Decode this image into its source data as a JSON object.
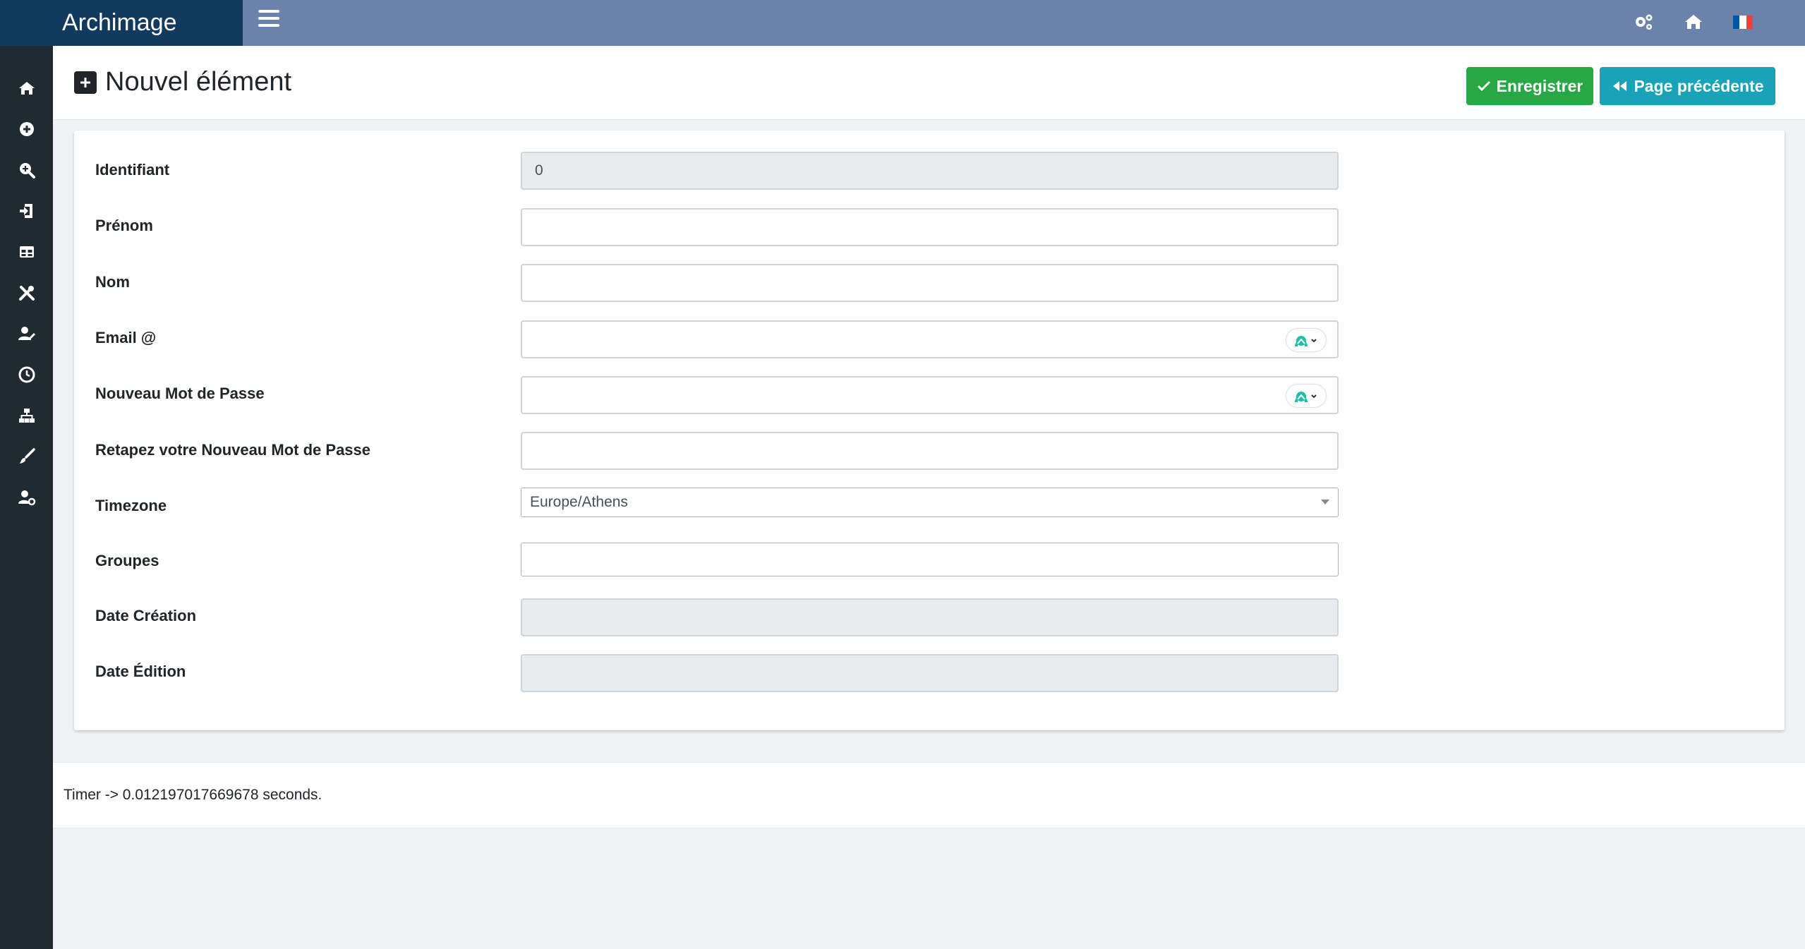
{
  "app": {
    "title": "Archimage"
  },
  "topbar": {
    "icons": [
      "gears-icon",
      "home-icon",
      "french-flag-icon"
    ],
    "flag_colors": [
      "#0055a4",
      "#ffffff",
      "#ef4135"
    ]
  },
  "sidebar": {
    "items": [
      {
        "icon": "home-icon"
      },
      {
        "icon": "plus-circle-icon"
      },
      {
        "icon": "search-plus-icon"
      },
      {
        "icon": "sign-in-icon"
      },
      {
        "icon": "table-icon"
      },
      {
        "icon": "tools-icon"
      },
      {
        "icon": "user-edit-icon"
      },
      {
        "icon": "clock-icon"
      },
      {
        "icon": "sitemap-icon"
      },
      {
        "icon": "brush-icon"
      },
      {
        "icon": "user-cog-icon"
      }
    ]
  },
  "page": {
    "title": "Nouvel élément"
  },
  "buttons": {
    "save": "Enregistrer",
    "back": "Page précédente"
  },
  "form": {
    "identifiant": {
      "label": "Identifiant",
      "value": "0"
    },
    "prenom": {
      "label": "Prénom",
      "value": ""
    },
    "nom": {
      "label": "Nom",
      "value": ""
    },
    "email": {
      "label": "Email @",
      "value": ""
    },
    "password": {
      "label": "Nouveau Mot de Passe",
      "value": ""
    },
    "password_confirm": {
      "label": "Retapez votre Nouveau Mot de Passe",
      "value": ""
    },
    "timezone": {
      "label": "Timezone",
      "value": "Europe/Athens"
    },
    "groupes": {
      "label": "Groupes",
      "value": ""
    },
    "date_creation": {
      "label": "Date Création",
      "value": ""
    },
    "date_edition": {
      "label": "Date Édition",
      "value": ""
    }
  },
  "footer": {
    "timer": "Timer -> 0.012197017669678 seconds."
  },
  "colors": {
    "brand_bg": "#12395e",
    "topbar_bg": "#6b82ab",
    "sidebar_bg": "#202b31",
    "save_button": "#28a745",
    "back_button": "#1aa3b8"
  }
}
